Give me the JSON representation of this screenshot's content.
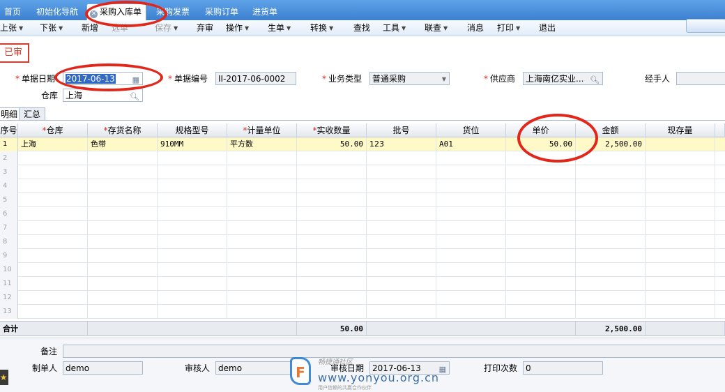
{
  "tabs": [
    "首页",
    "初始化导航",
    "采购入库单",
    "采购发票",
    "采购订单",
    "进货单"
  ],
  "active_tab_close_icon": "close-circle-icon",
  "toolbar": {
    "items": [
      {
        "label": "上张",
        "arrow": true,
        "enabled": true
      },
      {
        "label": "下张",
        "arrow": true,
        "enabled": true
      },
      {
        "label": "新增",
        "arrow": false,
        "enabled": true
      },
      {
        "label": "选单",
        "arrow": false,
        "enabled": false
      },
      {
        "label": "保存",
        "arrow": true,
        "enabled": false
      },
      {
        "label": "弃审",
        "arrow": false,
        "enabled": true
      },
      {
        "label": "操作",
        "arrow": true,
        "enabled": true
      },
      {
        "label": "生单",
        "arrow": true,
        "enabled": true
      },
      {
        "label": "转换",
        "arrow": true,
        "enabled": true
      },
      {
        "label": "查找",
        "arrow": false,
        "enabled": true
      },
      {
        "label": "工具",
        "arrow": true,
        "enabled": true
      },
      {
        "label": "联查",
        "arrow": true,
        "enabled": true
      },
      {
        "label": "消息",
        "arrow": false,
        "enabled": true
      },
      {
        "label": "打印",
        "arrow": true,
        "enabled": true
      },
      {
        "label": "退出",
        "arrow": false,
        "enabled": true
      }
    ]
  },
  "status_badge": "已审",
  "header": {
    "doc_date_label": "单据日期",
    "doc_date_value": "2017-06-13",
    "doc_no_label": "单据编号",
    "doc_no_value": "II-2017-06-0002",
    "biz_type_label": "业务类型",
    "biz_type_value": "普通采购",
    "supplier_label": "供应商",
    "supplier_value": "上海南亿实业...",
    "handler_label": "经手人",
    "handler_value": "",
    "warehouse_label": "仓库",
    "warehouse_value": "上海"
  },
  "detail_tabs": [
    "明细",
    "汇总"
  ],
  "grid": {
    "columns": [
      "序号",
      "仓库",
      "存货名称",
      "规格型号",
      "计量单位",
      "实收数量",
      "批号",
      "货位",
      "单价",
      "金额",
      "现存量"
    ],
    "required": [
      false,
      true,
      true,
      false,
      true,
      true,
      false,
      false,
      false,
      false,
      false
    ],
    "rows": [
      {
        "no": "1",
        "cells": [
          "上海",
          "色带",
          "910MM",
          "平方数",
          "50.00",
          "123",
          "A01",
          "50.00",
          "2,500.00",
          ""
        ]
      }
    ],
    "empty_row_numbers": [
      "2",
      "3",
      "4",
      "5",
      "6",
      "7",
      "8",
      "9",
      "10",
      "11",
      "12",
      "13"
    ],
    "total_label": "合计",
    "total_qty": "50.00",
    "total_amount": "2,500.00"
  },
  "footer": {
    "remark_label": "备注",
    "remark_value": "",
    "maker_label": "制单人",
    "maker_value": "demo",
    "auditor_label": "审核人",
    "auditor_value": "demo",
    "audit_date_label": "审核日期",
    "audit_date_value": "2017-06-13",
    "print_count_label": "打印次数",
    "print_count_value": "0"
  },
  "watermark": {
    "caption": "畅捷通社区",
    "url": "www.yonyou.org.cn",
    "tagline": "用户信赖的共赢合作伙伴"
  },
  "colors": {
    "tabbar": "#3d7fd0",
    "annotation": "#e0271a",
    "selected_row": "#fff9c8"
  }
}
